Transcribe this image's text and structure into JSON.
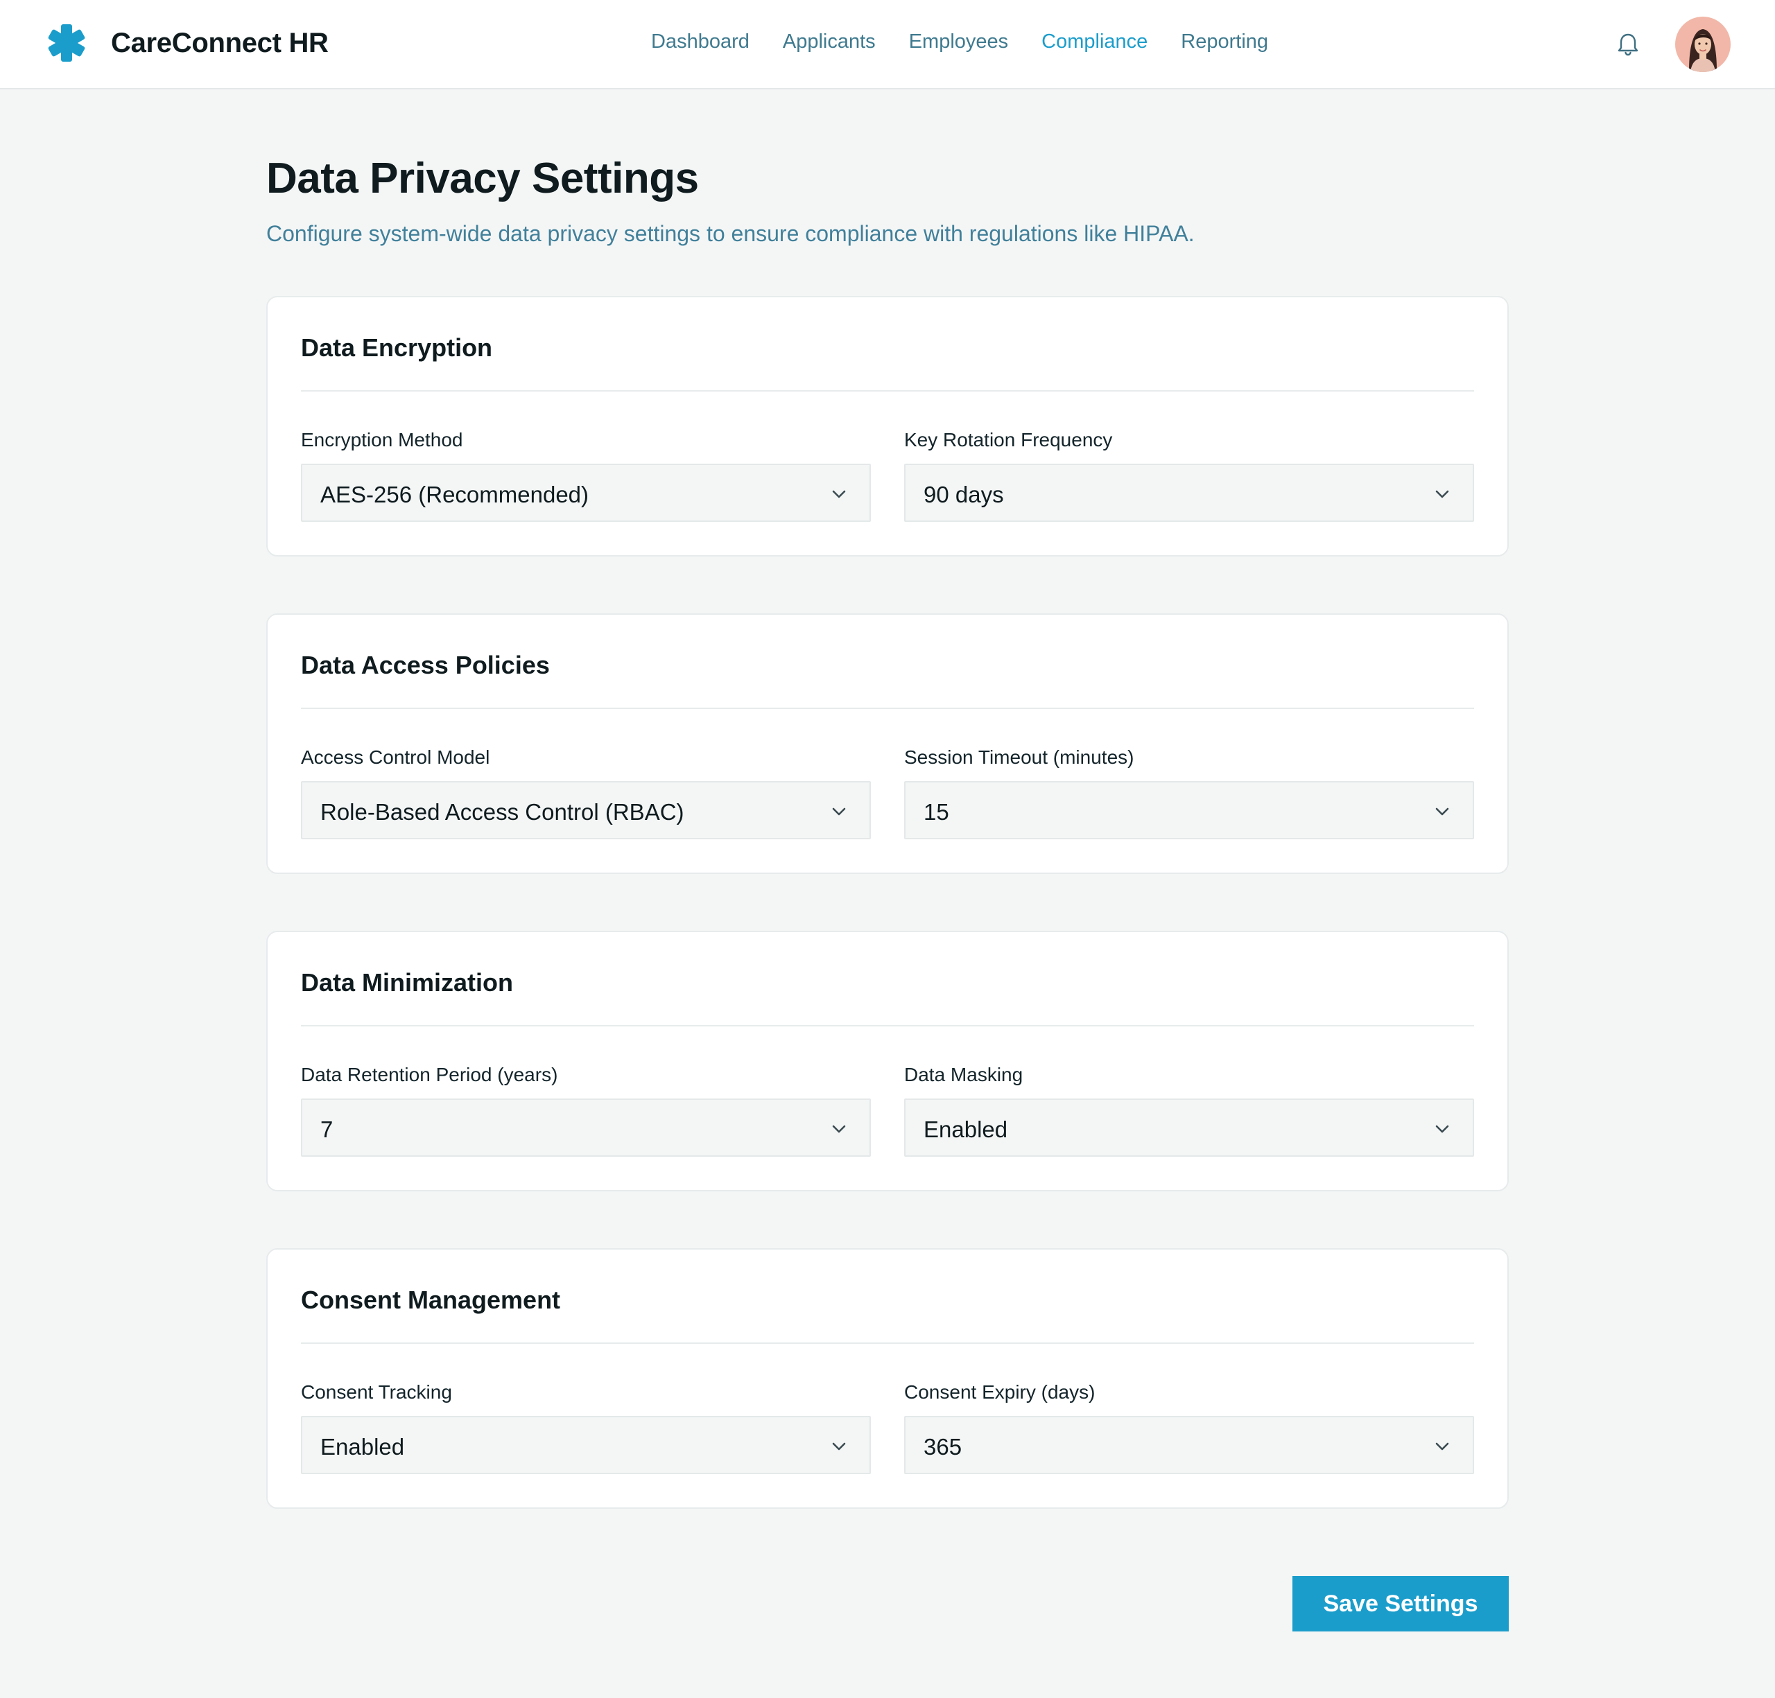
{
  "app": {
    "name": "CareConnect HR",
    "brand_color": "#1b9dcb"
  },
  "nav": {
    "items": [
      {
        "label": "Dashboard",
        "active": false
      },
      {
        "label": "Applicants",
        "active": false
      },
      {
        "label": "Employees",
        "active": false
      },
      {
        "label": "Compliance",
        "active": true
      },
      {
        "label": "Reporting",
        "active": false
      }
    ]
  },
  "header": {
    "notification_icon": "bell-icon",
    "avatar_icon": "user-avatar"
  },
  "page": {
    "title": "Data Privacy Settings",
    "subtitle": "Configure system-wide data privacy settings to ensure compliance with regulations like HIPAA."
  },
  "sections": [
    {
      "title": "Data Encryption",
      "fields": [
        {
          "label": "Encryption Method",
          "value": "AES-256 (Recommended)"
        },
        {
          "label": "Key Rotation Frequency",
          "value": "90 days"
        }
      ]
    },
    {
      "title": "Data Access Policies",
      "fields": [
        {
          "label": "Access Control Model",
          "value": "Role-Based Access Control (RBAC)"
        },
        {
          "label": "Session Timeout (minutes)",
          "value": "15"
        }
      ]
    },
    {
      "title": "Data Minimization",
      "fields": [
        {
          "label": "Data Retention Period (years)",
          "value": "7"
        },
        {
          "label": "Data Masking",
          "value": "Enabled"
        }
      ]
    },
    {
      "title": "Consent Management",
      "fields": [
        {
          "label": "Consent Tracking",
          "value": "Enabled"
        },
        {
          "label": "Consent Expiry (days)",
          "value": "365"
        }
      ]
    }
  ],
  "actions": {
    "save_label": "Save Settings"
  }
}
